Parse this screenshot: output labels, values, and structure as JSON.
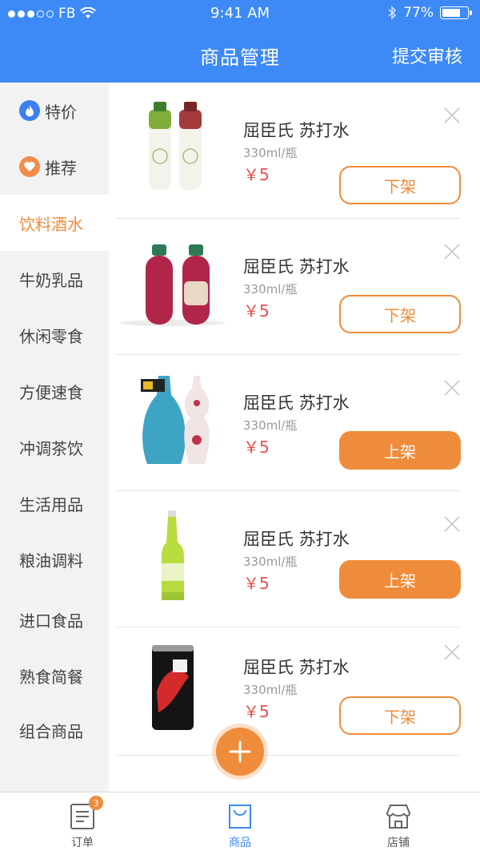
{
  "status_bar": {
    "carrier": "FB",
    "time": "9:41 AM",
    "battery": "77%",
    "battery_level": 0.77
  },
  "nav": {
    "title": "商品管理",
    "submit": "提交审核"
  },
  "sidebar": {
    "items": [
      {
        "label": "特价",
        "icon": "flame-icon"
      },
      {
        "label": "推荐",
        "icon": "heart-icon"
      },
      {
        "label": "饮料酒水",
        "active": true
      },
      {
        "label": "牛奶乳品"
      },
      {
        "label": "休闲零食"
      },
      {
        "label": "方便速食"
      },
      {
        "label": "冲调茶饮"
      },
      {
        "label": "生活用品"
      },
      {
        "label": "粮油调料"
      },
      {
        "label": "进口食品"
      },
      {
        "label": "熟食简餐"
      },
      {
        "label": "组合商品"
      }
    ]
  },
  "products": [
    {
      "name": "屈臣氏 苏打水",
      "spec": "330ml/瓶",
      "price": "￥5",
      "action": "下架"
    },
    {
      "name": "屈臣氏 苏打水",
      "spec": "330ml/瓶",
      "price": "￥5",
      "action": "下架"
    },
    {
      "name": "屈臣氏 苏打水",
      "spec": "330ml/瓶",
      "price": "￥5",
      "action": "上架"
    },
    {
      "name": "屈臣氏 苏打水",
      "spec": "330ml/瓶",
      "price": "￥5",
      "action": "上架"
    },
    {
      "name": "屈臣氏 苏打水",
      "spec": "330ml/瓶",
      "price": "￥5",
      "action": "下架"
    }
  ],
  "tabbar": {
    "items": [
      {
        "label": "订单",
        "badge": "3",
        "icon": "order-list-icon"
      },
      {
        "label": "商品",
        "icon": "bag-icon",
        "active": true
      },
      {
        "label": "店铺",
        "icon": "store-icon"
      }
    ]
  },
  "colors": {
    "primary": "#3d8af7",
    "accent": "#ef8c3b",
    "price": "#e5504a",
    "sidebar_bg": "#f2f2f2"
  }
}
